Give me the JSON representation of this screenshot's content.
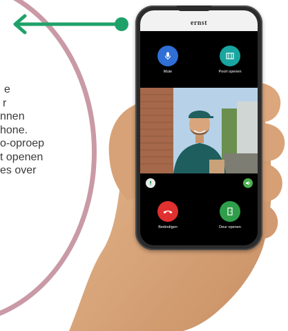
{
  "callout": {
    "lines": [
      "e",
      "r",
      "nnen",
      "hone.",
      "o-oproep",
      "t openen",
      "es over"
    ]
  },
  "phone": {
    "brand": "ernst",
    "controls": {
      "mute": {
        "label": "Mute",
        "icon": "microphone-icon",
        "color": "#2f6fd6"
      },
      "gate": {
        "label": "Poort openen",
        "icon": "gate-icon",
        "color": "#19a5a0"
      },
      "end": {
        "label": "Beëindigen",
        "icon": "phone-hangup-icon",
        "color": "#e03030"
      },
      "door": {
        "label": "Deur openen",
        "icon": "door-icon",
        "color": "#2f9e4a"
      }
    }
  },
  "colors": {
    "arrow": "#1fa26a",
    "callout_ring": "#c99aa6"
  }
}
